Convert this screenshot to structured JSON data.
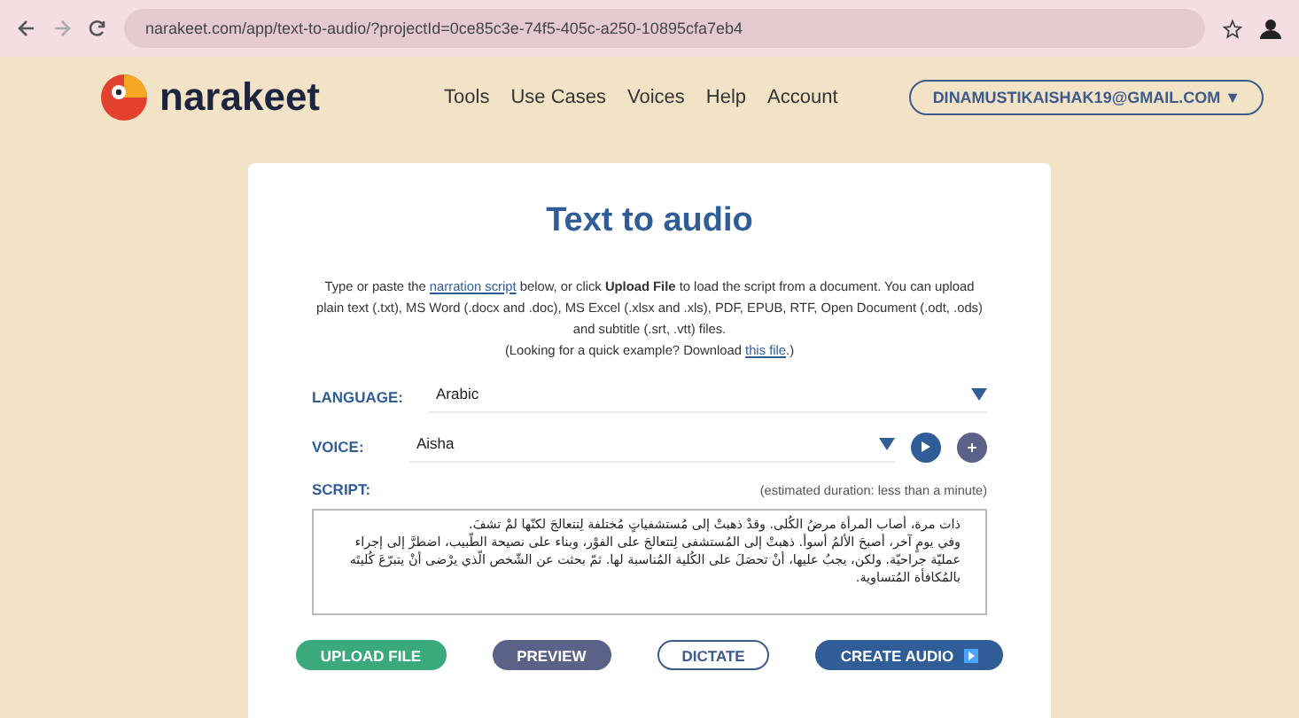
{
  "browser": {
    "url": "narakeet.com/app/text-to-audio/?projectId=0ce85c3e-74f5-405c-a250-10895cfa7eb4"
  },
  "header": {
    "brand": "narakeet",
    "nav": [
      "Tools",
      "Use Cases",
      "Voices",
      "Help",
      "Account"
    ],
    "account": "DINAMUSTIKAISHAK19@GMAIL.COM ▼"
  },
  "card": {
    "title": "Text to audio",
    "intro": [
      "Type or paste the ",
      "narration script",
      " below, or click **Upload File** to load the script from a document. You can upload plain text (.txt), MS Word (.docx and .doc), MS Excel (.xlsx and .xls), PDF, EPUB, RTF, Open Document (.odt, .ods) and subtitle (.srt, .vtt) files."
    ],
    "example": [
      "(Looking for a quick example? Download ",
      "this file",
      ".)"
    ],
    "language": {
      "label": "LANGUAGE:",
      "value": "Arabic"
    },
    "voice": {
      "label": "VOICE:",
      "value": "Aisha"
    },
    "script": {
      "label": "SCRIPT:",
      "duration": "(estimated duration: less than a minute)",
      "paragraphs": [
        "ذات مرة، أصاب المرأة مرضُ الكُلى. وقدْ ذهبتْ إلى مُستشفياتٍ مُختلفة لِتتعالجَ لكنّها لمْ تشفَ.",
        "وفي يومٍ آخر، أصبحَ الألمُ أسوأ. ذهبتْ إلى المُستشفى لِتتعالجَ على الفوْر، وبناء على نصيحة الطّبيب، اضطرَّ إلى إجراء عمليّة جراحيّة. ولكن، يجبُ عليها، أنْ تحصَلَ على الكُلية المُناسبة لها. ثمّ بحثت عن الشّخص الّذي يرْضى أنْ يتبرّعَ كُليتَه بالمُكافأة المُتساوية."
      ]
    },
    "buttons": [
      {
        "label": "UPLOAD FILE",
        "kind": "green"
      },
      {
        "label": "PREVIEW",
        "kind": "slate"
      },
      {
        "label": "DICTATE",
        "kind": "outline"
      },
      {
        "label": "CREATE AUDIO",
        "kind": "primary"
      }
    ]
  }
}
